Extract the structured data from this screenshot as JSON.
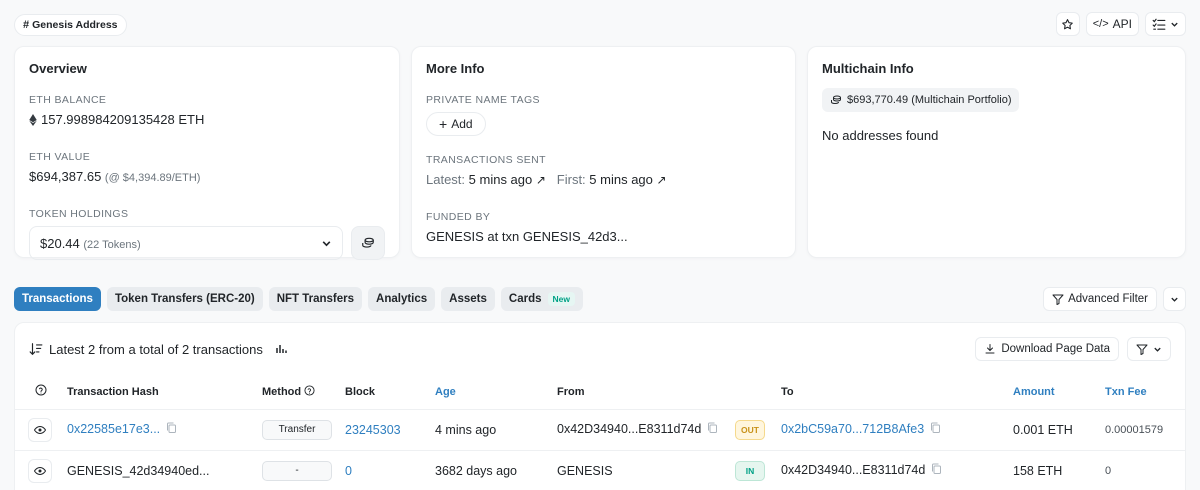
{
  "header": {
    "tag_label": "Genesis Address",
    "api_label": "API"
  },
  "overview": {
    "title": "Overview",
    "eth_balance_label": "ETH BALANCE",
    "eth_balance": "157.998984209135428 ETH",
    "eth_value_label": "ETH VALUE",
    "eth_value": "$694,387.65",
    "eth_price": "(@ $4,394.89/ETH)",
    "token_holdings_label": "TOKEN HOLDINGS",
    "token_value": "$20.44",
    "token_count": "(22 Tokens)"
  },
  "more_info": {
    "title": "More Info",
    "private_tags_label": "PRIVATE NAME TAGS",
    "add_label": "Add",
    "tx_sent_label": "TRANSACTIONS SENT",
    "latest_label": "Latest:",
    "latest_value": "5 mins ago",
    "first_label": "First:",
    "first_value": "5 mins ago",
    "funded_by_label": "FUNDED BY",
    "funded_by_value": "GENESIS at txn GENESIS_42d3..."
  },
  "multichain": {
    "title": "Multichain Info",
    "portfolio": "$693,770.49 (Multichain Portfolio)",
    "no_addresses": "No addresses found"
  },
  "tabs": [
    {
      "label": "Transactions"
    },
    {
      "label": "Token Transfers (ERC-20)"
    },
    {
      "label": "NFT Transfers"
    },
    {
      "label": "Analytics"
    },
    {
      "label": "Assets"
    },
    {
      "label": "Cards",
      "badge": "New"
    }
  ],
  "advanced_filter_label": "Advanced Filter",
  "tx_table": {
    "summary": "Latest 2 from a total of 2 transactions",
    "download_label": "Download Page Data",
    "columns": [
      "Transaction Hash",
      "Method",
      "Block",
      "Age",
      "From",
      "To",
      "Amount",
      "Txn Fee"
    ],
    "rows": [
      {
        "hash": "0x22585e17e3...",
        "method": "Transfer",
        "block": "23245303",
        "age": "4 mins ago",
        "from": "0x42D34940...E8311d74d",
        "direction": "OUT",
        "to": "0x2bC59a70...712B8Afe3",
        "amount": "0.001 ETH",
        "fee": "0.00001579"
      },
      {
        "hash": "GENESIS_42d34940ed...",
        "method": "-",
        "block": "0",
        "age": "3682 days ago",
        "from": "GENESIS",
        "direction": "IN",
        "to": "0x42D34940...E8311d74d",
        "amount": "158 ETH",
        "fee": "0"
      }
    ]
  },
  "colors": {
    "link": "#2f7fc0",
    "active_tab": "#2f7fc0",
    "in_badge": "#00a186",
    "out_badge": "#c8921a"
  }
}
